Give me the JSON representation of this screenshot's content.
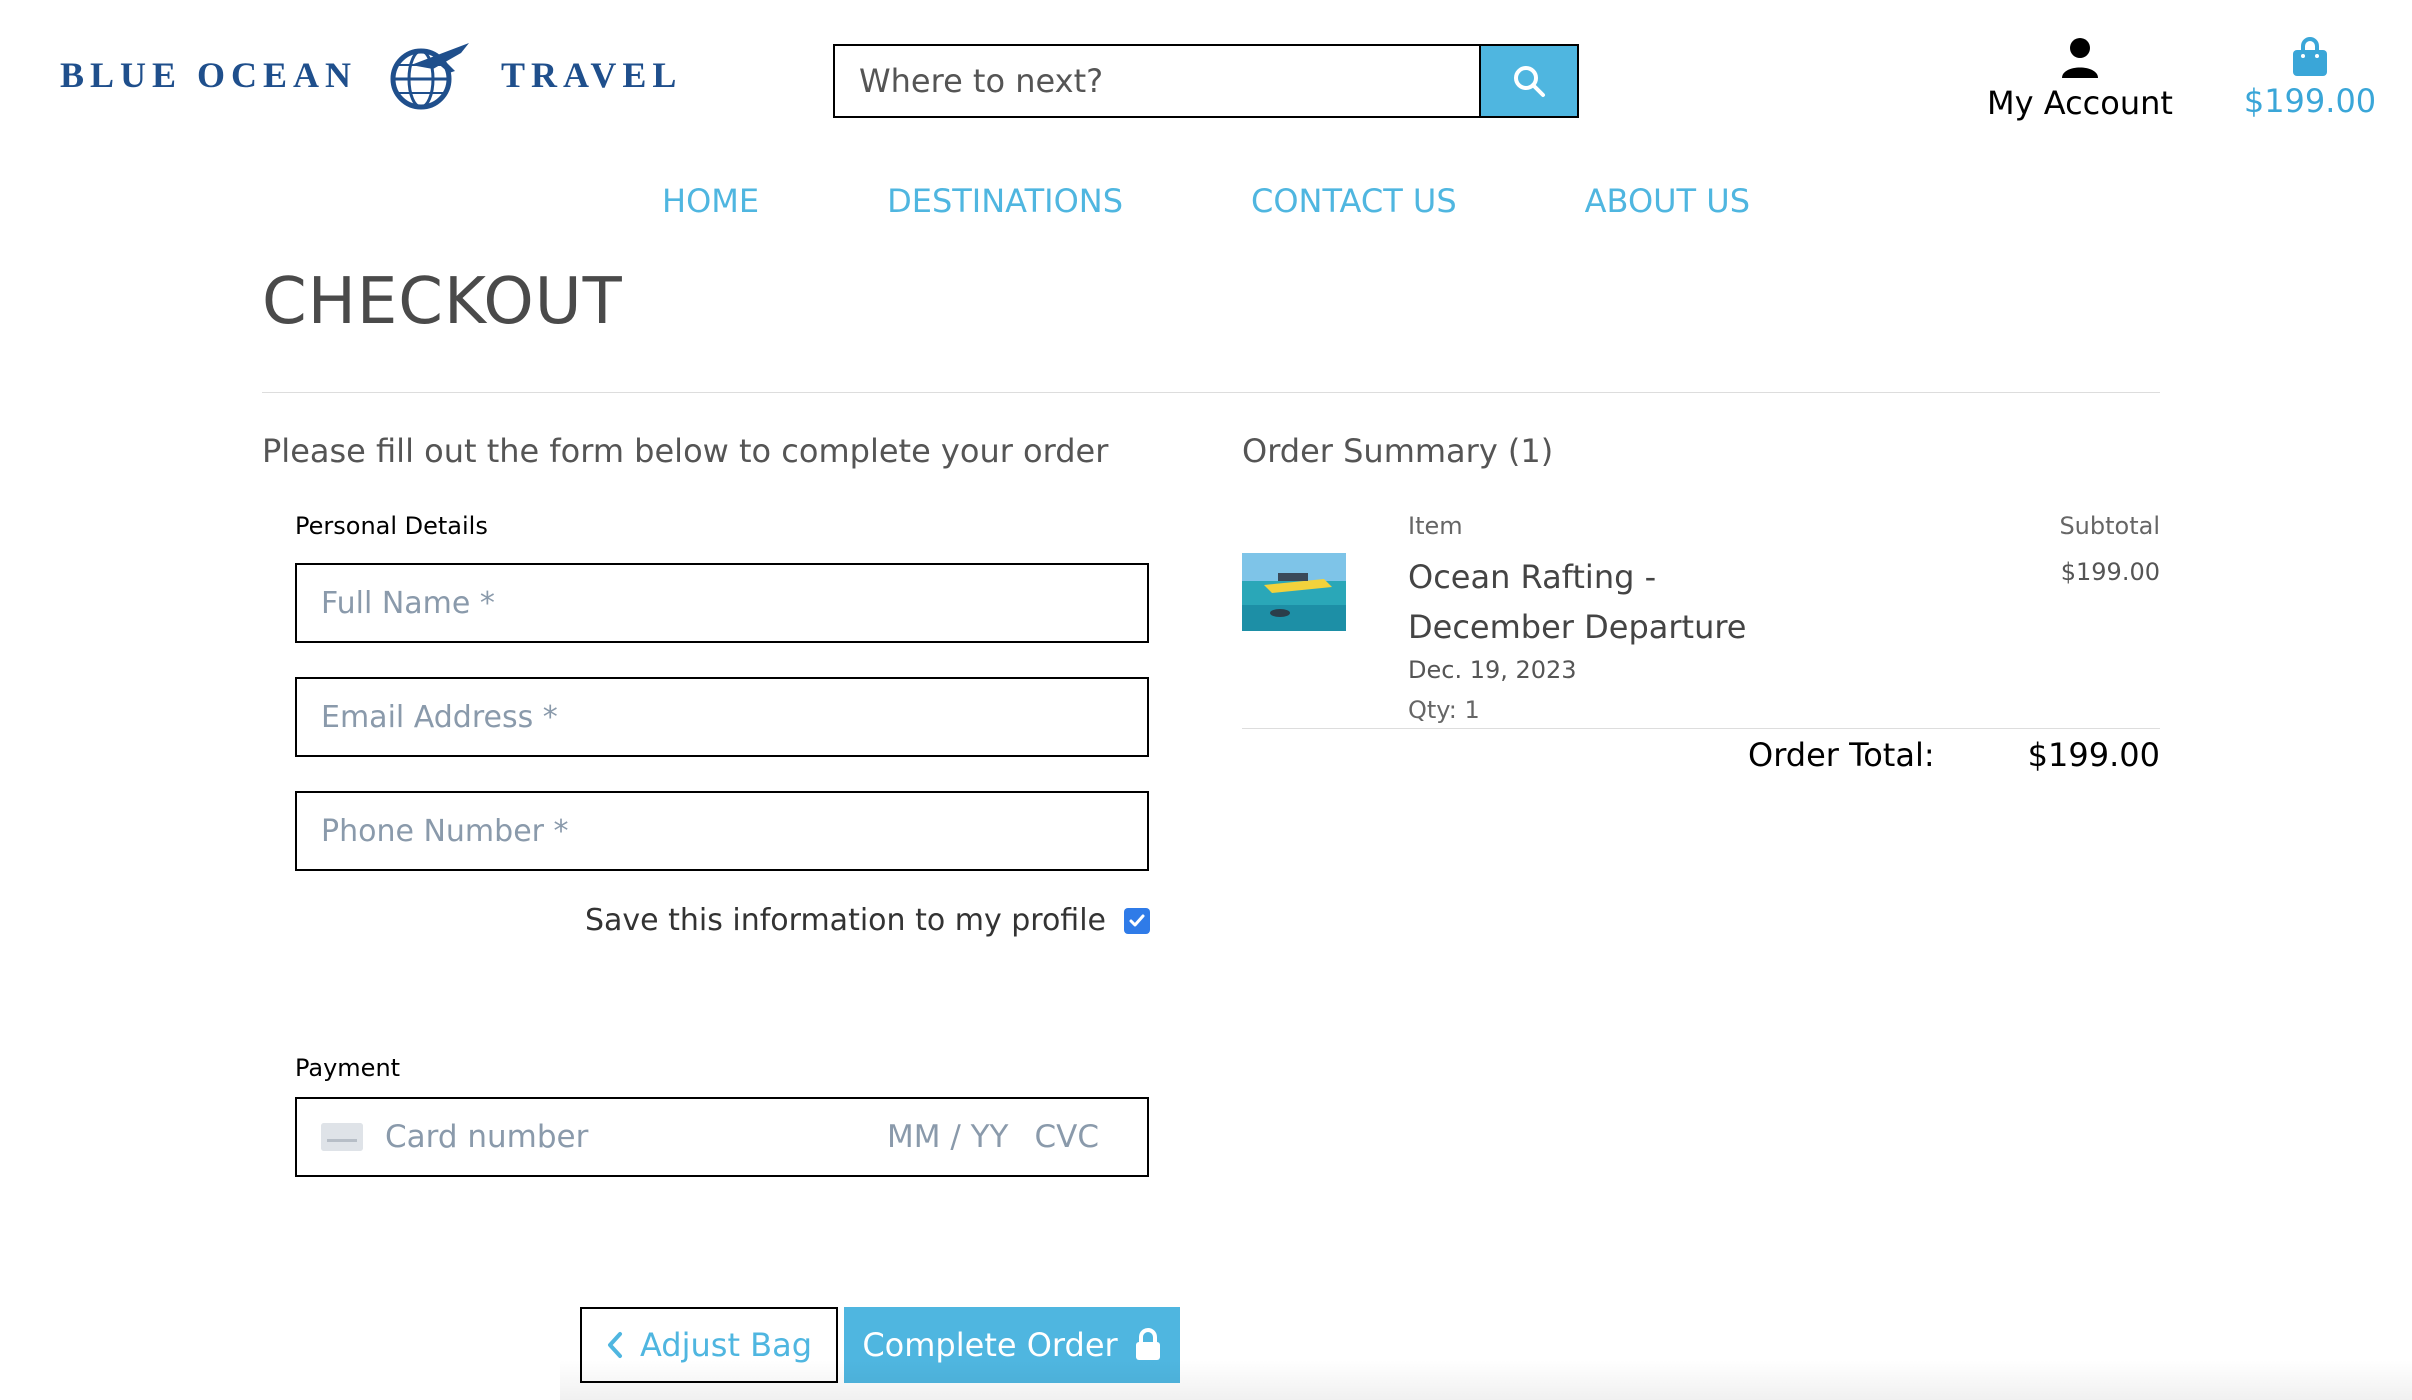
{
  "brand": {
    "word_left": "BLUE OCEAN",
    "word_right": "TRAVEL",
    "mark_icon": "globe-airplane-icon",
    "color": "#1f4f8c"
  },
  "search": {
    "placeholder": "Where to next?",
    "button_icon": "search-icon"
  },
  "account": {
    "label": "My Account",
    "icon": "user-icon"
  },
  "bag": {
    "amount": "$199.00",
    "icon": "shopping-bag-icon"
  },
  "nav": {
    "items": [
      {
        "label": "HOME"
      },
      {
        "label": "DESTINATIONS"
      },
      {
        "label": "CONTACT US"
      },
      {
        "label": "ABOUT US"
      }
    ]
  },
  "page": {
    "title": "CHECKOUT",
    "intro": "Please fill out the form below to complete your order"
  },
  "form": {
    "personal_label": "Personal Details",
    "full_name_placeholder": "Full Name *",
    "email_placeholder": "Email Address *",
    "phone_placeholder": "Phone Number *",
    "save_label": "Save this information to my profile",
    "save_checked": true,
    "payment_label": "Payment",
    "card_placeholder": "Card number",
    "exp_placeholder": "MM / YY",
    "cvc_placeholder": "CVC"
  },
  "actions": {
    "adjust_label": "Adjust Bag",
    "complete_label": "Complete Order"
  },
  "summary": {
    "title": "Order Summary (1)",
    "item_header": "Item",
    "subtotal_header": "Subtotal",
    "items": [
      {
        "name": "Ocean Rafting - December Departure",
        "date": "Dec. 19, 2023",
        "qty": "Qty: 1",
        "price": "$199.00"
      }
    ],
    "total_label": "Order Total:",
    "total_value": "$199.00"
  },
  "colors": {
    "accent": "#4fb6e0",
    "brand": "#1f4f8c",
    "checkbox": "#2f7be8"
  }
}
